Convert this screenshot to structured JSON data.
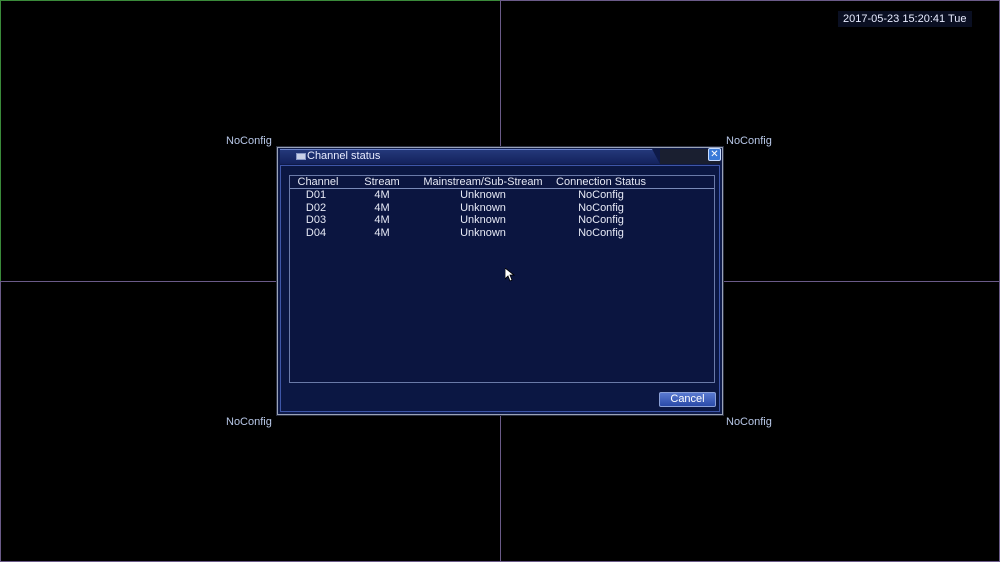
{
  "screen": {
    "datetime": "2017-05-23 15:20:41 Tue",
    "quadrants": [
      {
        "status": "NoConfig"
      },
      {
        "status": "NoConfig"
      },
      {
        "status": "NoConfig"
      },
      {
        "status": "NoConfig"
      }
    ]
  },
  "dialog": {
    "title": "Channel status",
    "close_icon": "close-icon",
    "title_icon": "window-icon",
    "table": {
      "headers": {
        "channel": "Channel",
        "stream": "Stream",
        "mainsub": "Mainstream/Sub-Stream",
        "connection": "Connection Status"
      },
      "rows": [
        {
          "channel": "D01",
          "stream": "4M",
          "mainsub": "Unknown",
          "connection": "NoConfig"
        },
        {
          "channel": "D02",
          "stream": "4M",
          "mainsub": "Unknown",
          "connection": "NoConfig"
        },
        {
          "channel": "D03",
          "stream": "4M",
          "mainsub": "Unknown",
          "connection": "NoConfig"
        },
        {
          "channel": "D04",
          "stream": "4M",
          "mainsub": "Unknown",
          "connection": "NoConfig"
        }
      ]
    },
    "cancel_label": "Cancel"
  },
  "colors": {
    "background": "#000000",
    "dialog_bg": "#0b1743",
    "text": "#e6e9f5",
    "accent": "#3a7ad8"
  }
}
